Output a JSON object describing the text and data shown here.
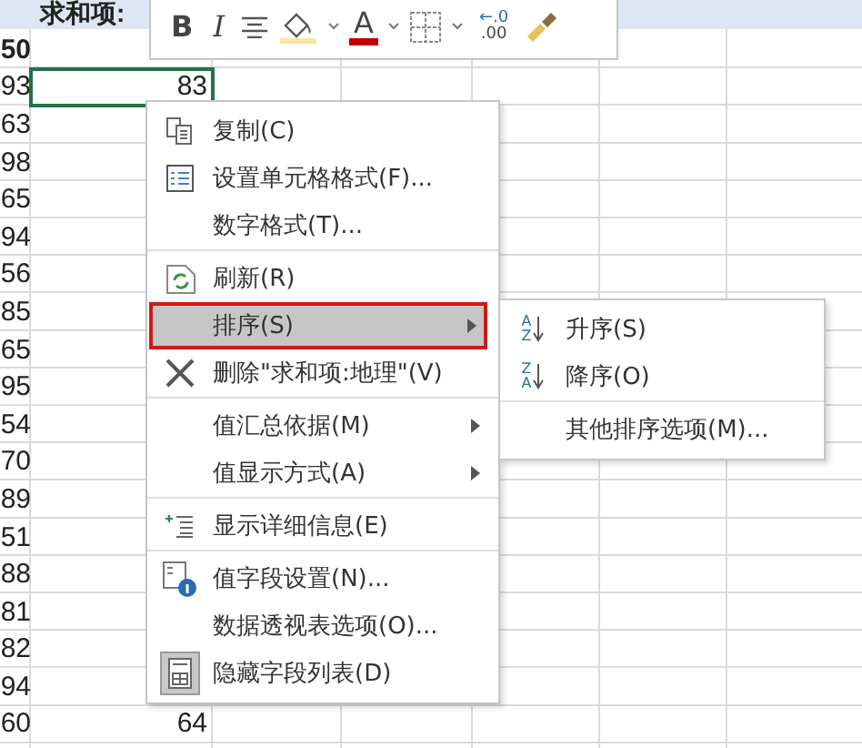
{
  "sheet": {
    "header": {
      "b": "求和项:"
    },
    "rows": [
      {
        "a": "50",
        "bold": true,
        "selected": false
      },
      {
        "a": "93",
        "b": "83",
        "bold": false,
        "selected": true
      },
      {
        "a": "63",
        "bold": false,
        "selected": false
      },
      {
        "a": "98",
        "bold": false,
        "selected": false
      },
      {
        "a": "65",
        "bold": false,
        "selected": false
      },
      {
        "a": "94",
        "bold": false,
        "selected": false
      },
      {
        "a": "56",
        "bold": false,
        "selected": false
      },
      {
        "a": "85",
        "bold": false,
        "selected": false
      },
      {
        "a": "65",
        "bold": false,
        "selected": false
      },
      {
        "a": "95",
        "bold": false,
        "selected": false
      },
      {
        "a": "54",
        "bold": false,
        "selected": false
      },
      {
        "a": "70",
        "bold": false,
        "selected": false
      },
      {
        "a": "89",
        "bold": false,
        "selected": false
      },
      {
        "a": "51",
        "bold": false,
        "selected": false
      },
      {
        "a": "88",
        "bold": false,
        "selected": false
      },
      {
        "a": "81",
        "bold": false,
        "selected": false
      },
      {
        "a": "82",
        "bold": false,
        "selected": false
      },
      {
        "a": "94",
        "bold": false,
        "selected": false
      },
      {
        "a": "60",
        "b": "64",
        "bold": false,
        "selected": false
      }
    ]
  },
  "toolbar": [
    {
      "kind": "bold",
      "label": "B"
    },
    {
      "kind": "italic",
      "label": "I"
    },
    {
      "kind": "align"
    },
    {
      "kind": "fill"
    },
    {
      "kind": "caret"
    },
    {
      "kind": "font-color",
      "label": "A"
    },
    {
      "kind": "caret"
    },
    {
      "kind": "borders"
    },
    {
      "kind": "caret"
    },
    {
      "kind": "decimal",
      "labels": [
        "←.0",
        ".00"
      ]
    },
    {
      "kind": "painter"
    }
  ],
  "context_menu": {
    "items": [
      {
        "label": "复制(C)",
        "submenu": false,
        "selected": false,
        "checked": false,
        "separator_after": false
      },
      {
        "label": "设置单元格格式(F)...",
        "submenu": false,
        "selected": false,
        "checked": false,
        "separator_after": false
      },
      {
        "label": "数字格式(T)...",
        "submenu": false,
        "selected": false,
        "checked": false,
        "separator_after": true
      },
      {
        "label": "刷新(R)",
        "submenu": false,
        "selected": false,
        "checked": false,
        "separator_after": false
      },
      {
        "label": "排序(S)",
        "submenu": true,
        "selected": true,
        "checked": false,
        "separator_after": false
      },
      {
        "label": "删除\"求和项:地理\"(V)",
        "submenu": false,
        "selected": false,
        "checked": false,
        "separator_after": true
      },
      {
        "label": "值汇总依据(M)",
        "submenu": true,
        "selected": false,
        "checked": false,
        "separator_after": false
      },
      {
        "label": "值显示方式(A)",
        "submenu": true,
        "selected": false,
        "checked": false,
        "separator_after": true
      },
      {
        "label": "显示详细信息(E)",
        "submenu": false,
        "selected": false,
        "checked": false,
        "separator_after": true
      },
      {
        "label": "值字段设置(N)...",
        "submenu": false,
        "selected": false,
        "checked": false,
        "separator_after": false
      },
      {
        "label": "数据透视表选项(O)...",
        "submenu": false,
        "selected": false,
        "checked": false,
        "separator_after": false
      },
      {
        "label": "隐藏字段列表(D)",
        "submenu": false,
        "selected": false,
        "checked": true,
        "separator_after": false
      }
    ]
  },
  "submenu": {
    "items": [
      {
        "label": "升序(S)",
        "icon_letters": [
          "A",
          "Z"
        ],
        "separator_after": false
      },
      {
        "label": "降序(O)",
        "icon_letters": [
          "Z",
          "A"
        ],
        "separator_after": true
      },
      {
        "label": "其他排序选项(M)...",
        "separator_after": false
      }
    ]
  }
}
